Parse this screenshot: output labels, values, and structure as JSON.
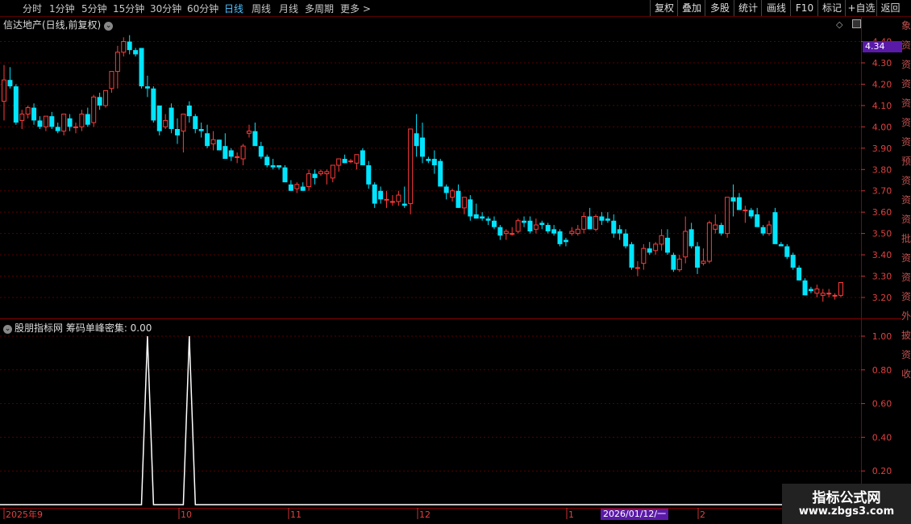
{
  "toolbar": {
    "left_items": [
      "分时",
      "1分钟",
      "5分钟",
      "15分钟",
      "30分钟",
      "60分钟",
      "日线",
      "周线",
      "月线",
      "多周期",
      "更多 >"
    ],
    "active_index": 6,
    "right_items": [
      "复权",
      "叠加",
      "多股",
      "统计",
      "画线",
      "F10",
      "标记",
      "+自选",
      "返回"
    ]
  },
  "main_title": "信达地产(日线,前复权)",
  "price_label": "4.34",
  "price_ticks": [
    "4.40",
    "4.30",
    "4.20",
    "4.10",
    "4.00",
    "3.90",
    "3.80",
    "3.70",
    "3.60",
    "3.50",
    "3.40",
    "3.30",
    "3.20"
  ],
  "indicator": {
    "title": "股朋指标网 筹码单峰密集: 0.00",
    "ticks": [
      "1.00",
      "0.80",
      "0.60",
      "0.40",
      "0.20"
    ]
  },
  "dates": {
    "labels": [
      "2025年9",
      "10",
      "11",
      "12",
      "1",
      "2"
    ],
    "cursor_label": "2026/01/12/一"
  },
  "right_strip": [
    "象",
    "资",
    "资",
    "资",
    "资",
    "资",
    "资",
    "预",
    "资",
    "资",
    "资",
    "批",
    "资",
    "资",
    "资",
    "外",
    "披",
    "资",
    "收"
  ],
  "watermark": {
    "line1": "指标公式网",
    "line2": "www.zbgs3.com"
  },
  "colors": {
    "up": "#ff3b3b",
    "down": "#00e5ff",
    "grid": "#5a0000",
    "indicator_line": "#ffffff",
    "accent": "#5a1aa8"
  },
  "chart_data": [
    {
      "type": "candlestick",
      "title": "信达地产(日线,前复权)",
      "y_range": [
        3.15,
        4.45
      ],
      "up_color": "#ff3b3b",
      "down_color": "#00e5ff",
      "candles": [
        [
          4.12,
          4.29,
          4.03,
          4.22
        ],
        [
          4.22,
          4.28,
          4.18,
          4.19
        ],
        [
          4.19,
          4.2,
          4.01,
          4.02
        ],
        [
          4.03,
          4.08,
          3.99,
          4.06
        ],
        [
          4.06,
          4.1,
          4.04,
          4.09
        ],
        [
          4.09,
          4.11,
          4.01,
          4.03
        ],
        [
          4.03,
          4.05,
          3.99,
          4.0
        ],
        [
          4.0,
          4.05,
          3.98,
          4.05
        ],
        [
          4.05,
          4.07,
          3.99,
          4.0
        ],
        [
          4.0,
          4.02,
          3.97,
          3.98
        ],
        [
          3.98,
          4.06,
          3.96,
          4.06
        ],
        [
          4.04,
          4.06,
          3.98,
          4.0
        ],
        [
          4.0,
          4.02,
          3.97,
          4.0
        ],
        [
          4.0,
          4.08,
          3.98,
          4.06
        ],
        [
          4.06,
          4.09,
          4.0,
          4.01
        ],
        [
          4.02,
          4.15,
          4.0,
          4.14
        ],
        [
          4.14,
          4.16,
          4.08,
          4.1
        ],
        [
          4.1,
          4.17,
          4.09,
          4.17
        ],
        [
          4.18,
          4.26,
          4.16,
          4.26
        ],
        [
          4.26,
          4.38,
          4.18,
          4.35
        ],
        [
          4.35,
          4.42,
          4.33,
          4.4
        ],
        [
          4.4,
          4.43,
          4.34,
          4.36
        ],
        [
          4.36,
          4.37,
          4.33,
          4.34
        ],
        [
          4.37,
          4.37,
          4.18,
          4.19
        ],
        [
          4.19,
          4.24,
          4.14,
          4.18
        ],
        [
          4.18,
          4.19,
          4.02,
          4.03
        ],
        [
          4.1,
          4.1,
          3.96,
          3.98
        ],
        [
          4.0,
          4.06,
          3.99,
          4.03
        ],
        [
          4.09,
          4.11,
          3.97,
          3.99
        ],
        [
          3.99,
          4.04,
          3.92,
          3.96
        ],
        [
          3.98,
          4.06,
          3.88,
          4.06
        ],
        [
          4.1,
          4.12,
          4.02,
          4.05
        ],
        [
          4.05,
          4.06,
          3.97,
          3.99
        ],
        [
          3.99,
          4.02,
          3.95,
          3.98
        ],
        [
          3.97,
          4.01,
          3.9,
          3.91
        ],
        [
          3.92,
          3.98,
          3.89,
          3.94
        ],
        [
          3.94,
          3.94,
          3.89,
          3.89
        ],
        [
          3.91,
          3.97,
          3.86,
          3.85
        ],
        [
          3.89,
          3.9,
          3.84,
          3.86
        ],
        [
          3.86,
          3.88,
          3.83,
          3.86
        ],
        [
          3.85,
          3.92,
          3.82,
          3.91
        ],
        [
          3.97,
          4.01,
          3.95,
          3.98
        ],
        [
          3.98,
          4.02,
          3.95,
          3.91
        ],
        [
          3.91,
          3.93,
          3.85,
          3.86
        ],
        [
          3.86,
          3.87,
          3.81,
          3.82
        ],
        [
          3.82,
          3.85,
          3.8,
          3.81
        ],
        [
          3.82,
          3.82,
          3.8,
          3.81
        ],
        [
          3.81,
          3.82,
          3.79,
          3.74
        ],
        [
          3.73,
          3.75,
          3.7,
          3.7
        ],
        [
          3.71,
          3.74,
          3.69,
          3.73
        ],
        [
          3.72,
          3.74,
          3.7,
          3.7
        ],
        [
          3.72,
          3.8,
          3.7,
          3.78
        ],
        [
          3.78,
          3.8,
          3.73,
          3.76
        ],
        [
          3.78,
          3.8,
          3.77,
          3.79
        ],
        [
          3.78,
          3.8,
          3.73,
          3.79
        ],
        [
          3.76,
          3.82,
          3.74,
          3.82
        ],
        [
          3.82,
          3.84,
          3.79,
          3.85
        ],
        [
          3.85,
          3.87,
          3.83,
          3.83
        ],
        [
          3.84,
          3.85,
          3.83,
          3.84
        ],
        [
          3.83,
          3.85,
          3.8,
          3.87
        ],
        [
          3.89,
          3.9,
          3.85,
          3.82
        ],
        [
          3.82,
          3.84,
          3.71,
          3.73
        ],
        [
          3.73,
          3.74,
          3.62,
          3.64
        ],
        [
          3.7,
          3.72,
          3.64,
          3.66
        ],
        [
          3.66,
          3.7,
          3.62,
          3.66
        ],
        [
          3.65,
          3.68,
          3.63,
          3.65
        ],
        [
          3.65,
          3.7,
          3.63,
          3.68
        ],
        [
          3.64,
          3.72,
          3.62,
          3.63
        ],
        [
          3.64,
          3.98,
          3.59,
          3.99
        ],
        [
          3.97,
          4.06,
          3.86,
          3.91
        ],
        [
          3.95,
          4.02,
          3.83,
          3.86
        ],
        [
          3.85,
          3.86,
          3.83,
          3.84
        ],
        [
          3.85,
          3.89,
          3.78,
          3.82
        ],
        [
          3.84,
          3.85,
          3.76,
          3.72
        ],
        [
          3.72,
          3.73,
          3.66,
          3.69
        ],
        [
          3.67,
          3.71,
          3.65,
          3.7
        ],
        [
          3.7,
          3.73,
          3.62,
          3.62
        ],
        [
          3.62,
          3.66,
          3.59,
          3.67
        ],
        [
          3.66,
          3.68,
          3.56,
          3.58
        ],
        [
          3.59,
          3.64,
          3.57,
          3.57
        ],
        [
          3.58,
          3.6,
          3.56,
          3.57
        ],
        [
          3.57,
          3.58,
          3.54,
          3.56
        ],
        [
          3.56,
          3.58,
          3.52,
          3.53
        ],
        [
          3.53,
          3.54,
          3.47,
          3.49
        ],
        [
          3.5,
          3.52,
          3.47,
          3.51
        ],
        [
          3.5,
          3.53,
          3.49,
          3.5
        ],
        [
          3.51,
          3.57,
          3.5,
          3.56
        ],
        [
          3.56,
          3.58,
          3.53,
          3.55
        ],
        [
          3.56,
          3.58,
          3.5,
          3.51
        ],
        [
          3.52,
          3.57,
          3.5,
          3.54
        ],
        [
          3.55,
          3.56,
          3.52,
          3.54
        ],
        [
          3.54,
          3.55,
          3.5,
          3.51
        ],
        [
          3.52,
          3.54,
          3.49,
          3.5
        ],
        [
          3.51,
          3.52,
          3.44,
          3.45
        ],
        [
          3.47,
          3.48,
          3.44,
          3.46
        ],
        [
          3.5,
          3.53,
          3.49,
          3.51
        ],
        [
          3.5,
          3.54,
          3.49,
          3.52
        ],
        [
          3.52,
          3.6,
          3.5,
          3.58
        ],
        [
          3.58,
          3.62,
          3.53,
          3.52
        ],
        [
          3.52,
          3.59,
          3.51,
          3.58
        ],
        [
          3.58,
          3.6,
          3.54,
          3.56
        ],
        [
          3.57,
          3.6,
          3.55,
          3.56
        ],
        [
          3.56,
          3.59,
          3.48,
          3.5
        ],
        [
          3.52,
          3.54,
          3.47,
          3.5
        ],
        [
          3.5,
          3.52,
          3.43,
          3.44
        ],
        [
          3.45,
          3.46,
          3.33,
          3.34
        ],
        [
          3.34,
          3.37,
          3.3,
          3.34
        ],
        [
          3.36,
          3.45,
          3.33,
          3.43
        ],
        [
          3.43,
          3.46,
          3.4,
          3.41
        ],
        [
          3.42,
          3.46,
          3.4,
          3.45
        ],
        [
          3.45,
          3.52,
          3.42,
          3.49
        ],
        [
          3.48,
          3.52,
          3.4,
          3.41
        ],
        [
          3.4,
          3.41,
          3.32,
          3.33
        ],
        [
          3.33,
          3.4,
          3.32,
          3.38
        ],
        [
          3.39,
          3.58,
          3.36,
          3.51
        ],
        [
          3.52,
          3.55,
          3.43,
          3.44
        ],
        [
          3.44,
          3.46,
          3.31,
          3.34
        ],
        [
          3.36,
          3.43,
          3.35,
          3.37
        ],
        [
          3.37,
          3.56,
          3.36,
          3.55
        ],
        [
          3.52,
          3.59,
          3.5,
          3.54
        ],
        [
          3.54,
          3.55,
          3.49,
          3.5
        ],
        [
          3.5,
          3.66,
          3.48,
          3.67
        ],
        [
          3.67,
          3.73,
          3.58,
          3.65
        ],
        [
          3.67,
          3.69,
          3.62,
          3.61
        ],
        [
          3.61,
          3.63,
          3.55,
          3.61
        ],
        [
          3.61,
          3.62,
          3.57,
          3.58
        ],
        [
          3.59,
          3.62,
          3.57,
          3.53
        ],
        [
          3.53,
          3.54,
          3.49,
          3.5
        ],
        [
          3.5,
          3.56,
          3.49,
          3.54
        ],
        [
          3.6,
          3.62,
          3.57,
          3.45
        ],
        [
          3.45,
          3.46,
          3.44,
          3.44
        ],
        [
          3.44,
          3.45,
          3.38,
          3.39
        ],
        [
          3.4,
          3.41,
          3.33,
          3.34
        ],
        [
          3.34,
          3.35,
          3.28,
          3.28
        ],
        [
          3.28,
          3.29,
          3.22,
          3.21
        ],
        [
          3.24,
          3.25,
          3.22,
          3.23
        ],
        [
          3.22,
          3.26,
          3.2,
          3.24
        ],
        [
          3.21,
          3.24,
          3.18,
          3.22
        ],
        [
          3.22,
          3.24,
          3.2,
          3.22
        ],
        [
          3.21,
          3.22,
          3.19,
          3.21
        ],
        [
          3.21,
          3.27,
          3.2,
          3.27
        ]
      ]
    },
    {
      "type": "line",
      "title": "股朋指标网 筹码单峰密集: 0.00",
      "y_range": [
        0,
        1.05
      ],
      "spikes_at_index": [
        24,
        31
      ],
      "baseline_value": 0
    }
  ]
}
